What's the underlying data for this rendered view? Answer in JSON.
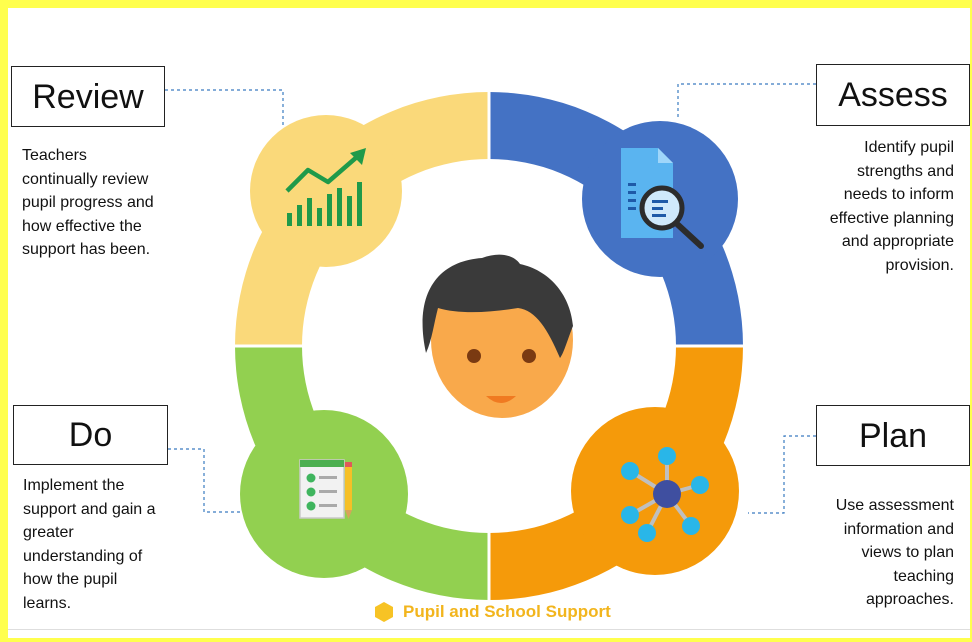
{
  "stages": {
    "review": {
      "title": "Review",
      "lines": [
        "Teachers",
        "continually review",
        "pupil progress and",
        "how effective the",
        "support has been."
      ],
      "color": "#fad97a",
      "icon": "bar-chart-trend-icon"
    },
    "assess": {
      "title": "Assess",
      "lines": [
        "Identify pupil",
        "strengths and",
        "needs to inform",
        "effective planning",
        "and appropriate",
        "provision."
      ],
      "color": "#4472c4",
      "icon": "document-magnifier-icon"
    },
    "plan": {
      "title": "Plan",
      "lines": [
        "Use assessment",
        "information and",
        "views to plan",
        "teaching",
        "approaches."
      ],
      "color": "#f59a0a",
      "icon": "network-nodes-icon"
    },
    "do": {
      "title": "Do",
      "lines": [
        "Implement the",
        "support and gain a",
        "greater",
        "understanding of",
        "how the pupil",
        "learns."
      ],
      "color": "#92d050",
      "icon": "checklist-pencil-icon"
    }
  },
  "center": {
    "icon": "pupil-face-icon",
    "skin": "#f9a94b",
    "hair": "#3a3a3a"
  },
  "footer": {
    "brand": "Pupil and School Support",
    "color": "#f2b51d"
  }
}
